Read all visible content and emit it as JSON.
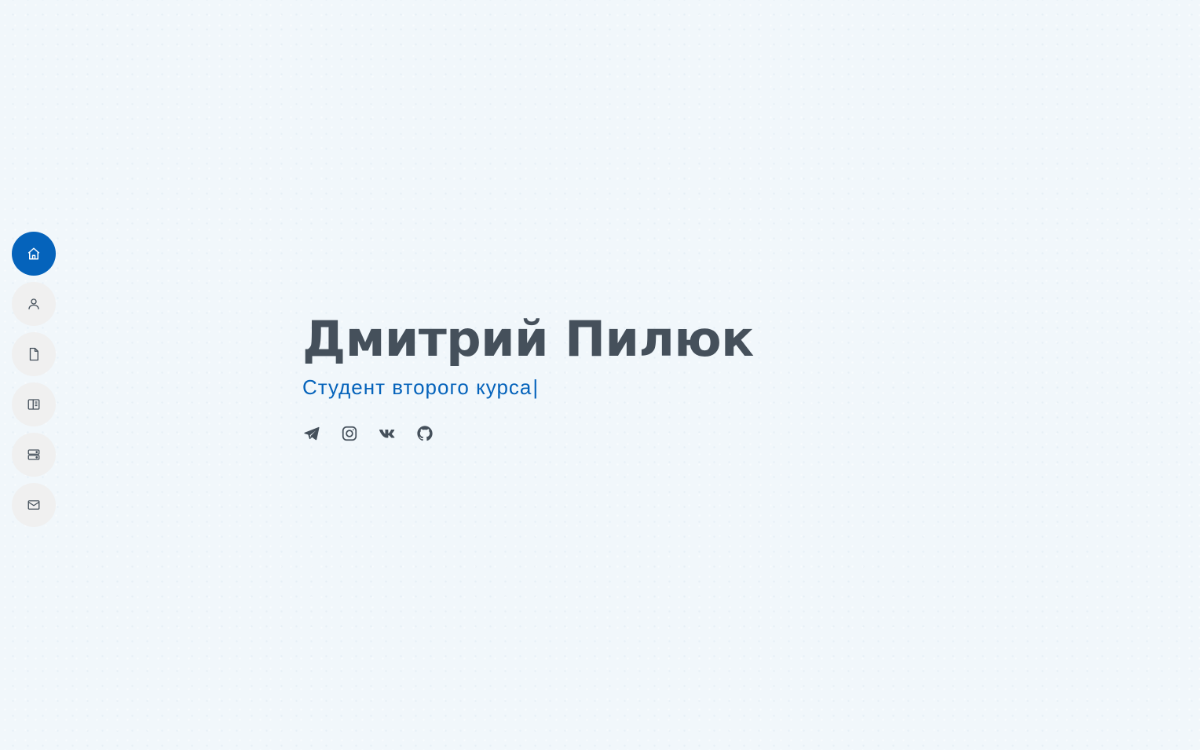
{
  "hero": {
    "name": "Дмитрий Пилюк",
    "subtitle": "Студент второго курса",
    "cursor": "|"
  },
  "nav": {
    "items": [
      {
        "icon": "home-icon",
        "active": true
      },
      {
        "icon": "user-icon",
        "active": false
      },
      {
        "icon": "file-icon",
        "active": false
      },
      {
        "icon": "book-icon",
        "active": false
      },
      {
        "icon": "server-icon",
        "active": false
      },
      {
        "icon": "envelope-icon",
        "active": false
      }
    ]
  },
  "social": [
    {
      "icon": "telegram-icon"
    },
    {
      "icon": "instagram-icon"
    },
    {
      "icon": "vk-icon"
    },
    {
      "icon": "github-icon"
    }
  ],
  "colors": {
    "accent": "#0563bb",
    "text": "#45505b",
    "background": "#f1f7fb",
    "nav_bg": "#f0f0f0"
  }
}
